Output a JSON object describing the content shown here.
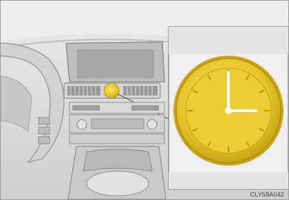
{
  "figure": {
    "code": "CLY58A042",
    "description_icon": "analog-clock-icon",
    "colors": {
      "clock_gold": "#e9c92f",
      "clock_face": "#f3d945",
      "hands": "#ffffff",
      "dash_light": "#e0e0e0",
      "dash_mid": "#c4c4c4",
      "dash_dark": "#8f8f8f"
    }
  },
  "clock": {
    "hour": 3,
    "minute": 0
  }
}
